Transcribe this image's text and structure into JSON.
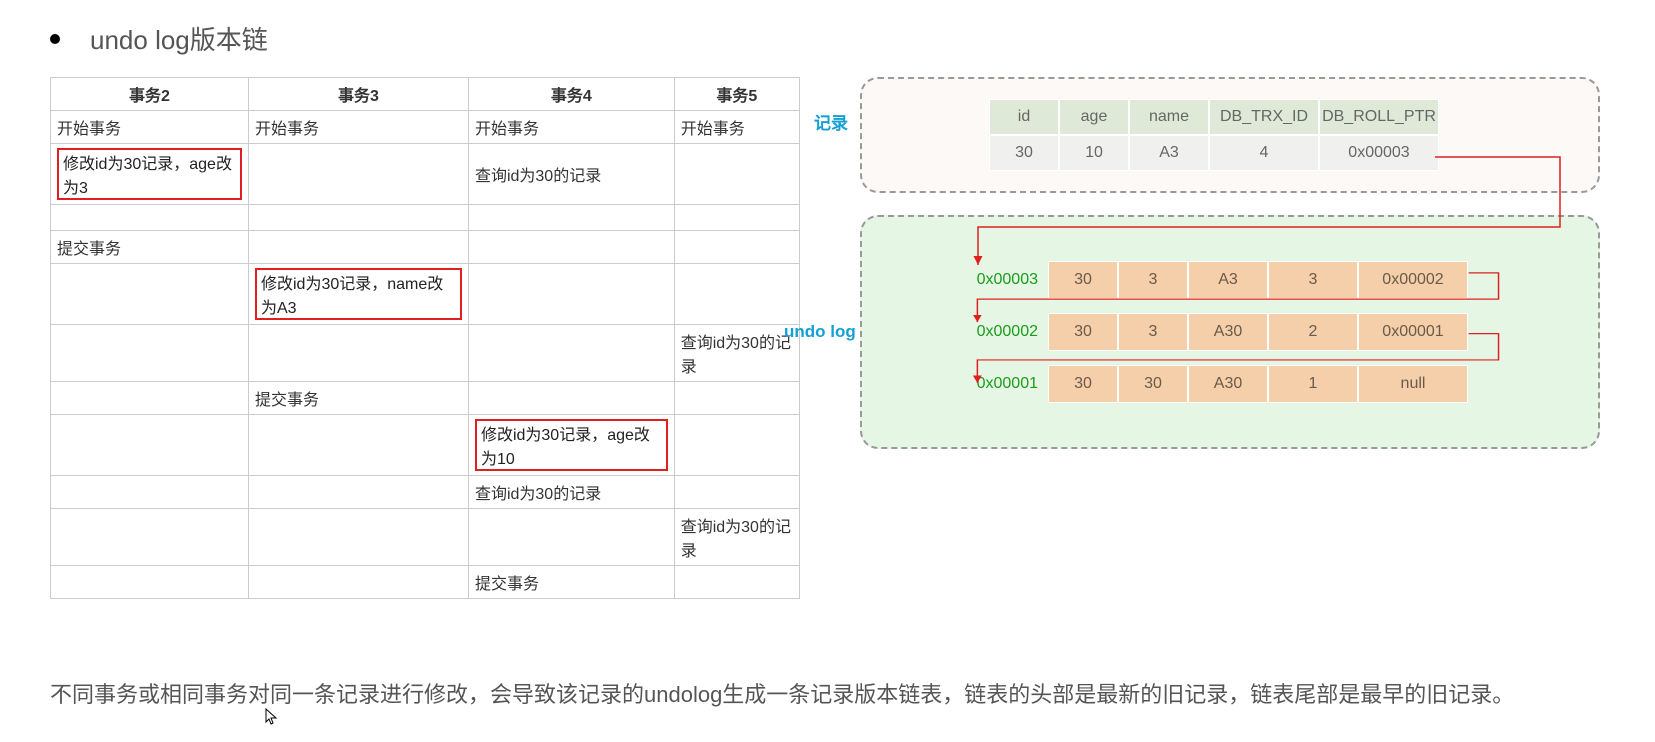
{
  "title": "undo log版本链",
  "tx_headers": [
    "事务2",
    "事务3",
    "事务4",
    "事务5"
  ],
  "tx_rows": [
    {
      "cells": [
        "开始事务",
        "开始事务",
        "开始事务",
        "开始事务"
      ],
      "hl": []
    },
    {
      "cells": [
        "修改id为30记录，age改为3",
        "",
        "查询id为30的记录",
        ""
      ],
      "hl": [
        0
      ]
    },
    {
      "cells": [
        "",
        "",
        "",
        ""
      ],
      "hl": []
    },
    {
      "cells": [
        "提交事务",
        "",
        "",
        ""
      ],
      "hl": []
    },
    {
      "cells": [
        "",
        "修改id为30记录，name改为A3",
        "",
        ""
      ],
      "hl": [
        1
      ]
    },
    {
      "cells": [
        "",
        "",
        "",
        "查询id为30的记录"
      ],
      "hl": []
    },
    {
      "cells": [
        "",
        "提交事务",
        "",
        ""
      ],
      "hl": []
    },
    {
      "cells": [
        "",
        "",
        "修改id为30记录，age改为10",
        ""
      ],
      "hl": [
        2
      ]
    },
    {
      "cells": [
        "",
        "",
        "查询id为30的记录",
        ""
      ],
      "hl": []
    },
    {
      "cells": [
        "",
        "",
        "",
        "查询id为30的记录"
      ],
      "hl": []
    },
    {
      "cells": [
        "",
        "",
        "提交事务",
        ""
      ],
      "hl": []
    }
  ],
  "record": {
    "label": "记录",
    "headers": [
      "id",
      "age",
      "name",
      "DB_TRX_ID",
      "DB_ROLL_PTR"
    ],
    "values": [
      "30",
      "10",
      "A3",
      "4",
      "0x00003"
    ]
  },
  "undo": {
    "label": "undo log",
    "rows": [
      {
        "addr": "0x00003",
        "cells": [
          "30",
          "3",
          "A3",
          "3",
          "0x00002"
        ]
      },
      {
        "addr": "0x00002",
        "cells": [
          "30",
          "3",
          "A30",
          "2",
          "0x00001"
        ]
      },
      {
        "addr": "0x00001",
        "cells": [
          "30",
          "30",
          "A30",
          "1",
          "null"
        ]
      }
    ]
  },
  "bottom_text": "不同事务或相同事务对同一条记录进行修改，会导致该记录的undolog生成一条记录版本链表，链表的头部是最新的旧记录，链表尾部是最早的旧记录。"
}
